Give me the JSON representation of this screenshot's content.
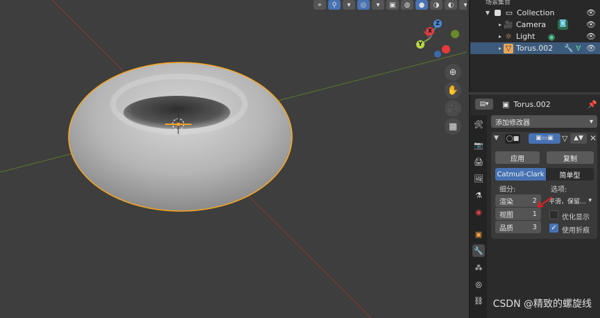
{
  "outliner": {
    "header": "场景集合",
    "items": [
      {
        "label": "Collection",
        "icon": "collection-icon"
      },
      {
        "label": "Camera",
        "icon": "camera-icon"
      },
      {
        "label": "Light",
        "icon": "light-icon"
      },
      {
        "label": "Torus.002",
        "icon": "mesh-icon",
        "selected": true
      }
    ]
  },
  "properties": {
    "object_name": "Torus.002",
    "add_modifier": "添加修改器",
    "apply": "应用",
    "copy": "复制",
    "mode_catmull": "Catmull-Clark",
    "mode_simple": "简单型",
    "subdivision_label": "细分:",
    "options_label": "选项:",
    "render_label": "渲染",
    "render_value": "2",
    "viewport_label": "视图",
    "viewport_value": "1",
    "quality_label": "品质",
    "quality_value": "3",
    "uv_smooth": "平滑，保留...",
    "optimal_display": "优化显示",
    "use_creases": "使用折痕"
  },
  "gizmo": {
    "x": "X",
    "y": "Y",
    "z": "Z"
  },
  "watermark": "CSDN @精致的螺旋线",
  "colors": {
    "accent": "#4772b3",
    "selection": "#f5a623"
  }
}
